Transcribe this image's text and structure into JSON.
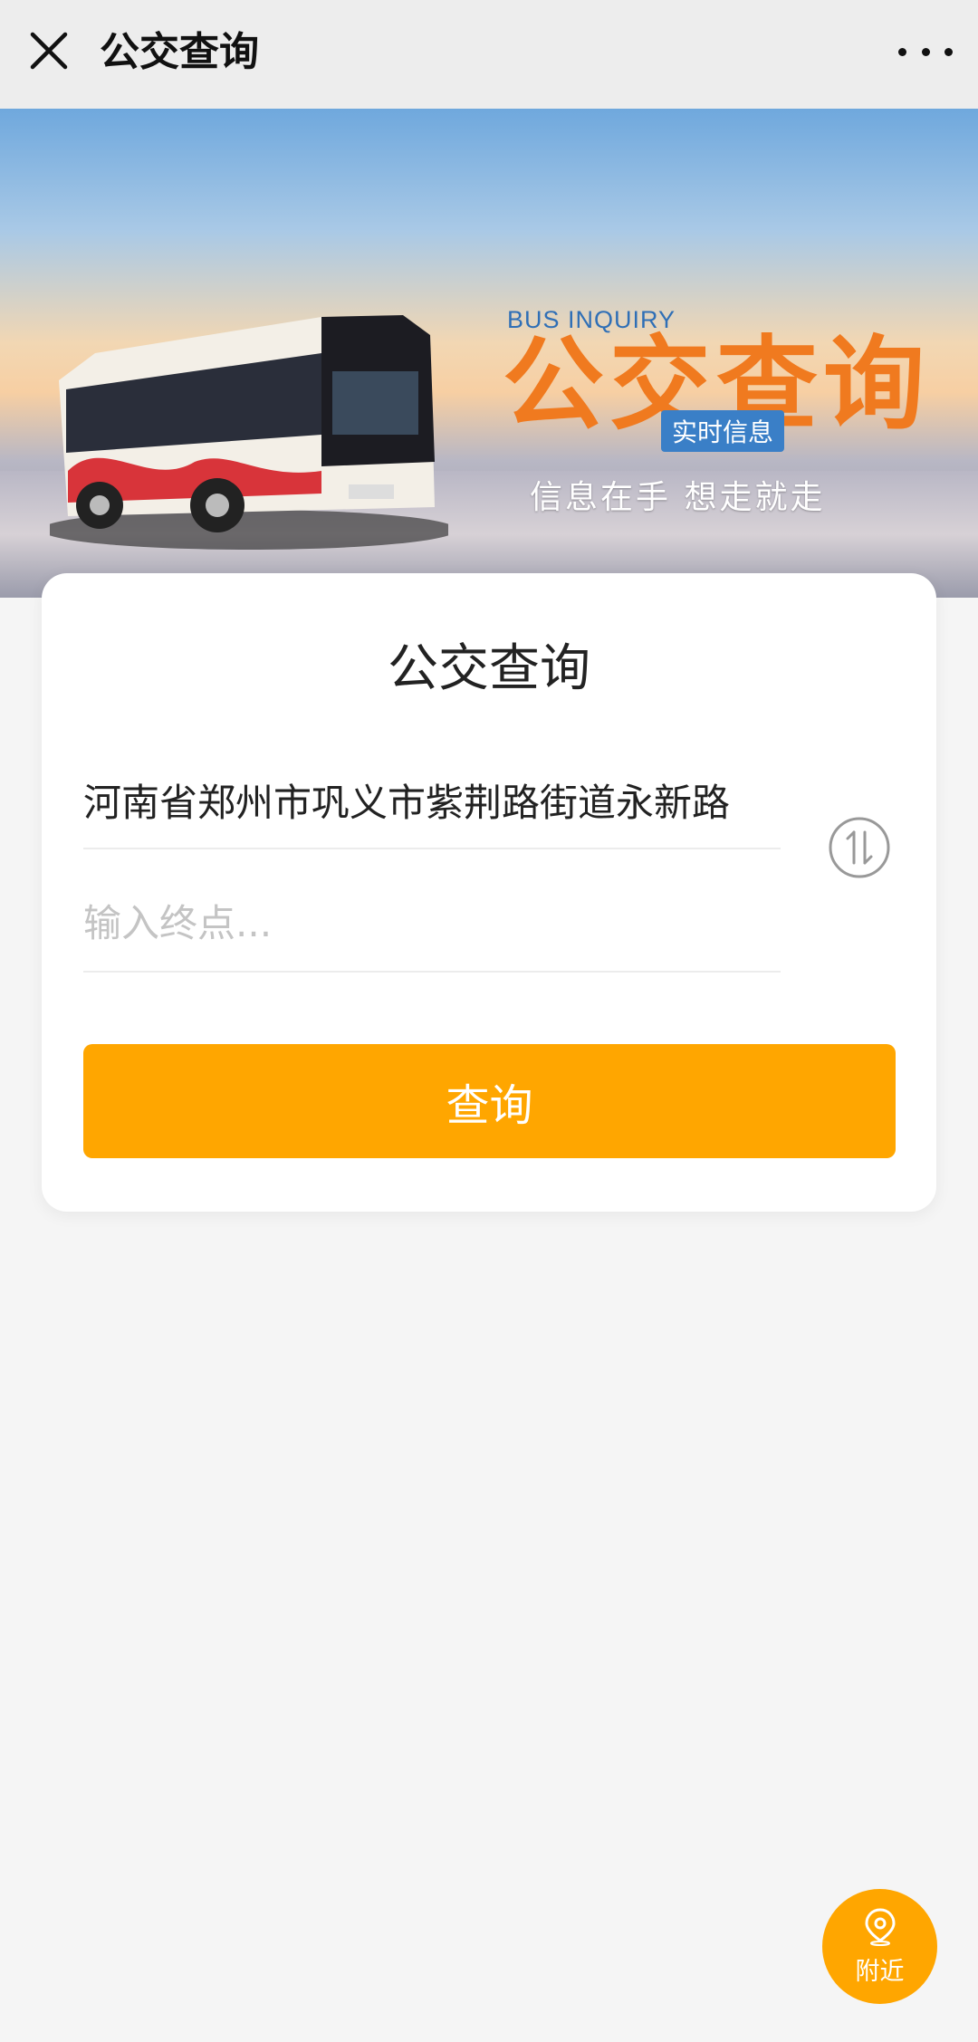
{
  "topbar": {
    "title": "公交查询",
    "close_icon": "close-icon",
    "more_icon": "more-dots-icon"
  },
  "banner": {
    "subtitle_en": "BUS INQUIRY",
    "title_cn": "公交查询",
    "tag": "实时信息",
    "slogan": "信息在手 想走就走"
  },
  "card": {
    "title": "公交查询",
    "start_value": "河南省郑州市巩义市紫荆路街道永新路",
    "end_placeholder": "输入终点...",
    "swap_icon": "swap-arrows-icon",
    "query_label": "查询"
  },
  "nearby": {
    "label": "附近",
    "icon": "location-pin-icon"
  },
  "colors": {
    "accent": "#ffa600",
    "banner_title": "#f07a1f",
    "banner_tag": "#3a7fc7"
  }
}
